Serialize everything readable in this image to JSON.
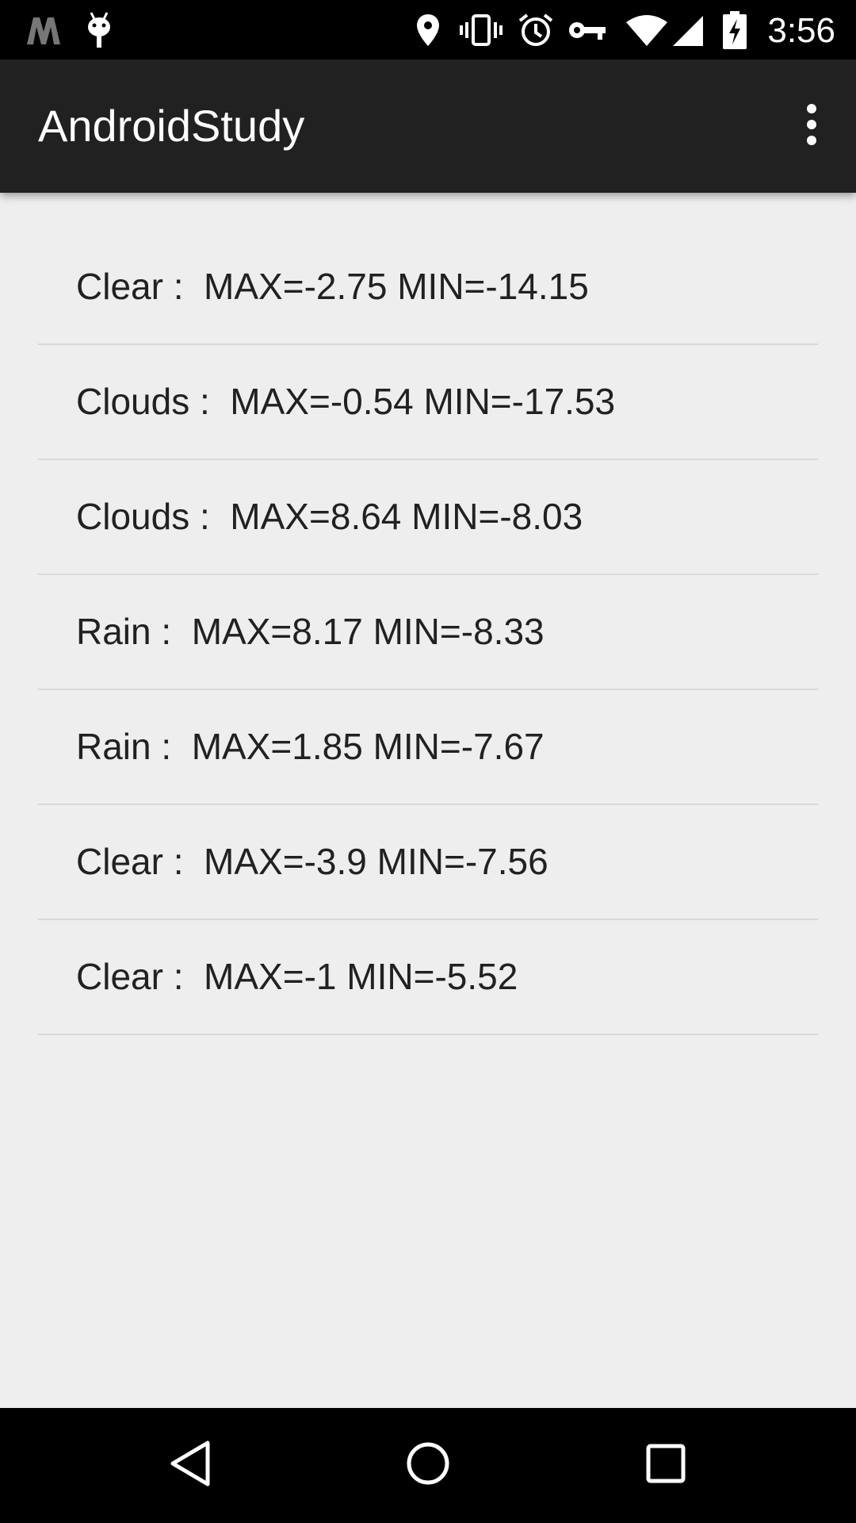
{
  "status_bar": {
    "time": "3:56",
    "left_icons": [
      "m-logo-icon",
      "android-debug-icon"
    ],
    "right_icons": [
      "location-icon",
      "vibrate-icon",
      "alarm-icon",
      "vpn-key-icon",
      "wifi-icon",
      "cell-signal-icon",
      "battery-charging-icon"
    ]
  },
  "app_bar": {
    "title": "AndroidStudy",
    "overflow_icon": "more-vert-icon"
  },
  "list": {
    "items": [
      {
        "text": "Clear :  MAX=-2.75 MIN=-14.15"
      },
      {
        "text": "Clouds :  MAX=-0.54 MIN=-17.53"
      },
      {
        "text": "Clouds :  MAX=8.64 MIN=-8.03"
      },
      {
        "text": "Rain :  MAX=8.17 MIN=-8.33"
      },
      {
        "text": "Rain :  MAX=1.85 MIN=-7.67"
      },
      {
        "text": "Clear :  MAX=-3.9 MIN=-7.56"
      },
      {
        "text": "Clear :  MAX=-1 MIN=-5.52"
      }
    ]
  },
  "nav_bar": {
    "buttons": [
      "back-icon",
      "home-icon",
      "recents-icon"
    ]
  },
  "colors": {
    "status_bar": "#000000",
    "app_bar": "#212121",
    "background": "#eeeeee",
    "divider": "#d8d8d8",
    "text": "#212121"
  }
}
